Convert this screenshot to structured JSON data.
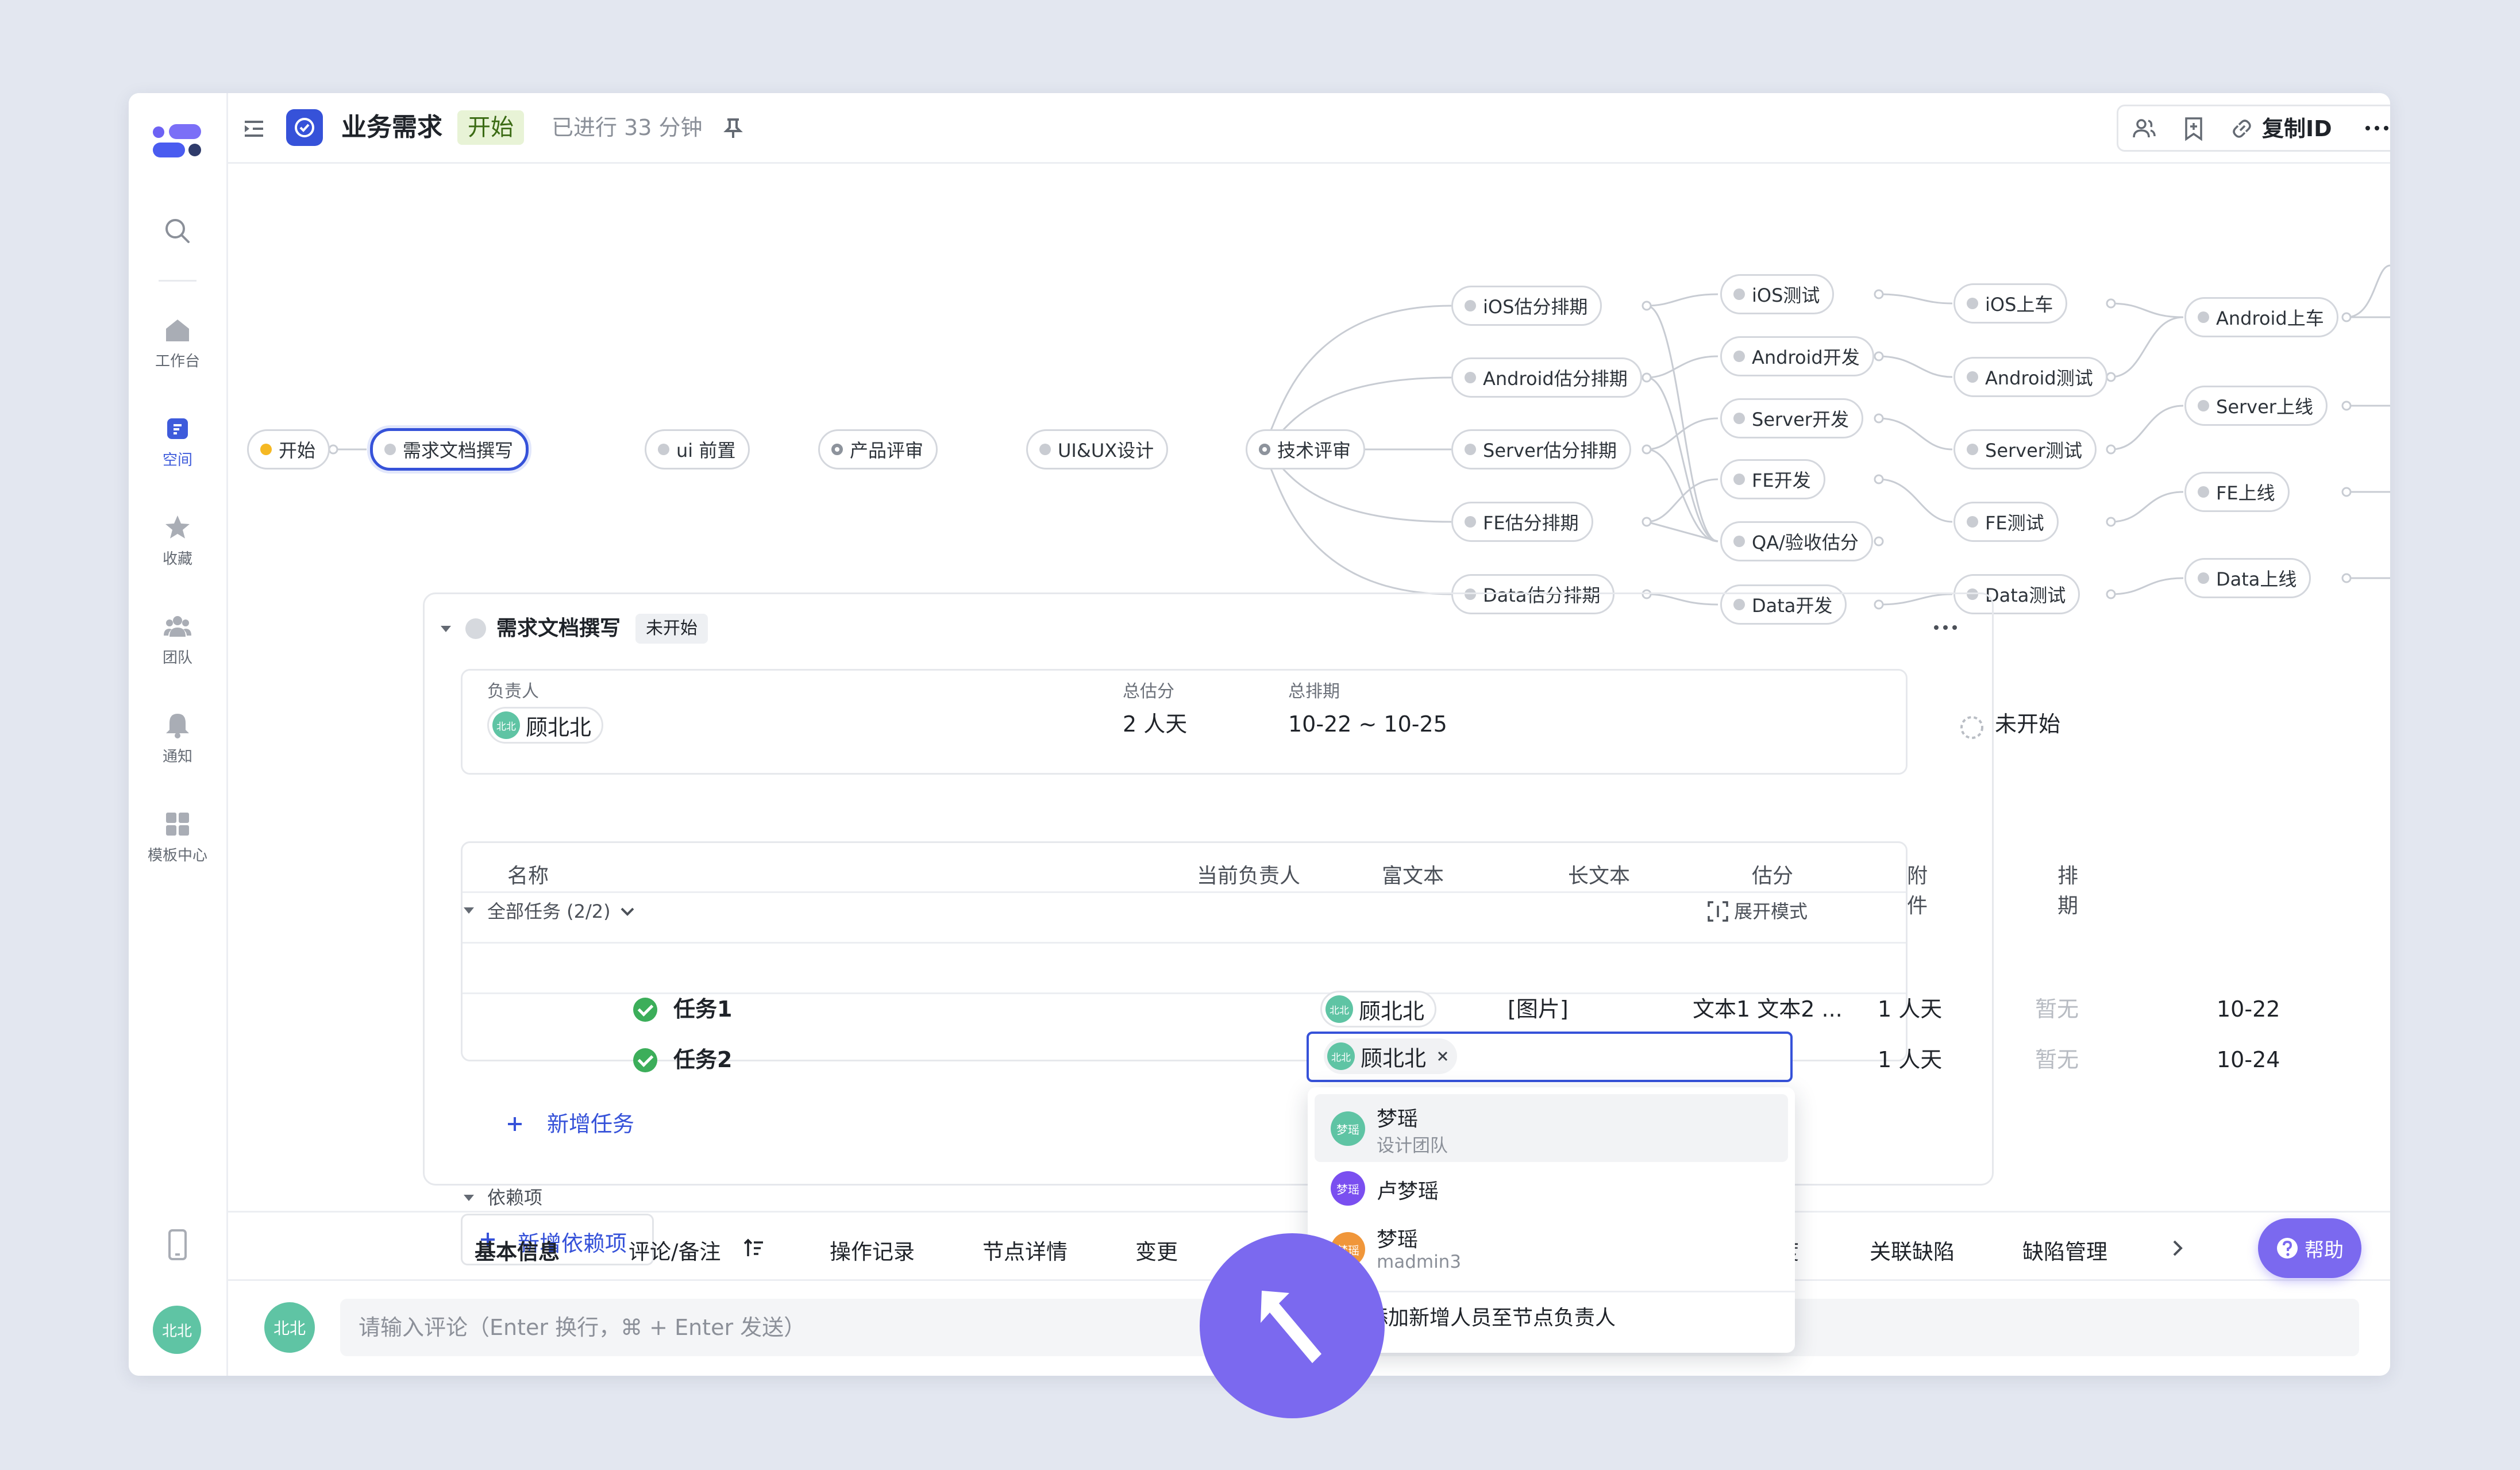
{
  "colors": {
    "accent": "#3652d9",
    "purple": "#7b69ef",
    "success": "#3cae5a",
    "avatar_teal": "#5fc4a4"
  },
  "sidebar": {
    "items": [
      {
        "label": "工作台",
        "icon": "home-icon"
      },
      {
        "label": "空间",
        "icon": "space-icon"
      },
      {
        "label": "收藏",
        "icon": "star-icon"
      },
      {
        "label": "团队",
        "icon": "team-icon"
      },
      {
        "label": "通知",
        "icon": "bell-icon"
      },
      {
        "label": "模板中心",
        "icon": "template-icon"
      }
    ],
    "user_avatar": "北北"
  },
  "header": {
    "title": "业务需求",
    "status": "开始",
    "elapsed": "已进行 33 分钟",
    "copy_id": "复制ID"
  },
  "flow": {
    "main": [
      "开始",
      "需求文档撰写",
      "ui 前置",
      "产品评审",
      "UI&UX设计",
      "技术评审"
    ],
    "col1": [
      "iOS估分排期",
      "Android估分排期",
      "Server估分排期",
      "FE估分排期",
      "Data估分排期"
    ],
    "col2": [
      "iOS测试",
      "Android开发",
      "Server开发",
      "FE开发",
      "QA/验收估分",
      "Data开发"
    ],
    "col3": [
      "iOS上车",
      "Android测试",
      "Server测试",
      "FE测试",
      "Data测试"
    ],
    "col4": [
      "Android上车",
      "Server上线",
      "FE上线",
      "Data上线"
    ]
  },
  "task": {
    "title": "需求文档撰写",
    "status": "未开始",
    "owner_label": "负责人",
    "owner": "顾北北",
    "owner_avatar": "北北",
    "estimate_label": "总估分",
    "estimate": "2 人天",
    "schedule_label": "总排期",
    "schedule": "10-22 ~ 10-25",
    "state": "未开始",
    "all_tasks": "全部任务 (2/2)",
    "expand_mode": "展开模式",
    "columns": [
      "名称",
      "当前负责人",
      "富文本",
      "长文本",
      "估分",
      "附件",
      "排期"
    ],
    "rows": [
      {
        "name": "任务1",
        "owner": "顾北北",
        "rich": "[图片]",
        "long": "文本1 文本2 ...",
        "estimate": "1 人天",
        "attach": "暂无",
        "date": "10-22"
      },
      {
        "name": "任务2",
        "owner": "顾北北",
        "rich": "",
        "long": "",
        "estimate": "1 人天",
        "attach": "暂无",
        "date": "10-24"
      }
    ],
    "add_task": "新增任务",
    "deps": "依赖项",
    "add_dep": "新增依赖项"
  },
  "picker": {
    "options": [
      {
        "name": "梦瑶",
        "sub": "设计团队",
        "avatar": "梦瑶",
        "color": "#5fc4a4"
      },
      {
        "name": "卢梦瑶",
        "sub": "",
        "avatar": "梦瑶",
        "color": "#7a4ff0"
      },
      {
        "name": "梦瑶",
        "sub": "madmin3",
        "avatar": "梦瑶",
        "color": "#f0963a"
      }
    ],
    "checkbox_label": "添加新增人员至节点负责人"
  },
  "tabs": [
    "基本信息",
    "评论/备注",
    "操作记录",
    "节点详情",
    "变更",
    "度",
    "关联缺陷",
    "缺陷管理"
  ],
  "help": "帮助",
  "comment": {
    "avatar": "北北",
    "placeholder": "请输入评论（Enter 换行，⌘ + Enter 发送）"
  }
}
